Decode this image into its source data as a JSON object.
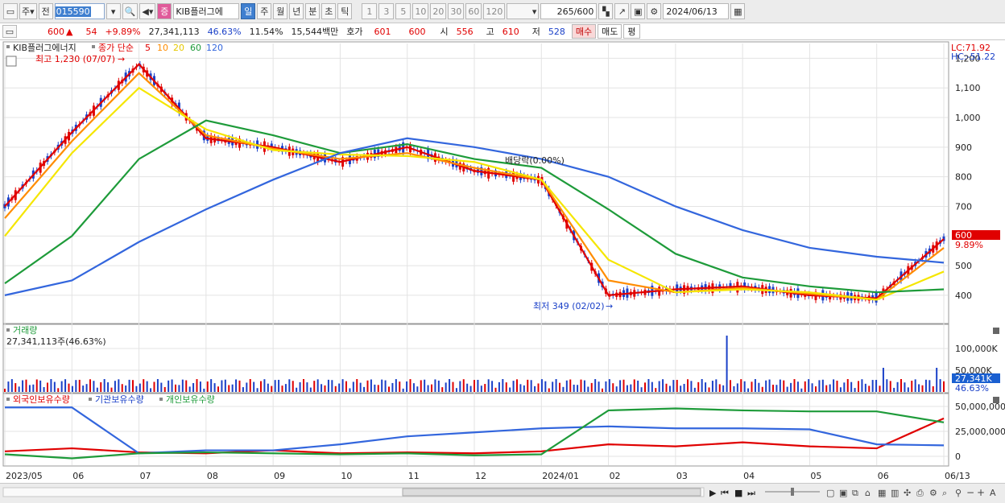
{
  "toolbar": {
    "market": "주",
    "prev": "전",
    "code": "015590",
    "name": "KIB플러그에",
    "periods": [
      "일",
      "주",
      "월",
      "년",
      "분",
      "초",
      "틱"
    ],
    "active_period": "일",
    "minutes": [
      "1",
      "3",
      "5",
      "10",
      "20",
      "30",
      "60",
      "120"
    ],
    "count": "265/600",
    "date": "2024/06/13"
  },
  "info": {
    "price": "600",
    "change": "54",
    "change_pct": "+9.89%",
    "volume": "27,341,113",
    "volume_ratio": "46.63%",
    "turnover": "11.54%",
    "amount": "15,544백만",
    "quote_label": "호가",
    "ask": "601",
    "bid": "600",
    "open_label": "시",
    "open": "556",
    "high_label": "고",
    "high": "610",
    "low_label": "저",
    "low": "528",
    "buy": "매수",
    "sell": "매도",
    "eval": "평"
  },
  "price_panel": {
    "legend_name": "KIB플러그에너지",
    "legend_ma": "종가 단순",
    "ma_periods": [
      "5",
      "10",
      "20",
      "60",
      "120"
    ],
    "ma_colors": [
      "#e00000",
      "#ff8c00",
      "#f5e600",
      "#1e9b3a",
      "#3366dd"
    ],
    "high_label": "최고 1,230 (07/07)",
    "low_label": "최저 349 (02/02)",
    "dividend_label": "배당락(0.00%)",
    "lc": "LC:71.92",
    "hc": "HC:-51.22",
    "current_price_tag": "600",
    "current_pct_tag": "9.89%",
    "y_ticks": [
      "1,200",
      "1,100",
      "1,000",
      "900",
      "800",
      "700",
      "600",
      "500",
      "400"
    ]
  },
  "volume_panel": {
    "title": "거래량",
    "value": "27,341,113주(46.63%)",
    "y_ticks": [
      "100,000K",
      "50,000K"
    ],
    "tag": "27,341K",
    "tag_pct": "46.63%"
  },
  "holdings_panel": {
    "legend": [
      "외국인보유수량",
      "기관보유수량",
      "개인보유수량"
    ],
    "y_ticks": [
      "50,000,000",
      "25,000,000",
      "0"
    ]
  },
  "x_axis": [
    "2023/05",
    "06",
    "07",
    "08",
    "09",
    "10",
    "11",
    "12",
    "2024/01",
    "02",
    "03",
    "04",
    "05",
    "06",
    "06/13"
  ],
  "chart_data": {
    "type": "line",
    "title": "",
    "xlabel": "",
    "ylabel": "",
    "x": [
      "2023/05",
      "06",
      "07",
      "08",
      "09",
      "10",
      "11",
      "12",
      "2024/01",
      "02",
      "03",
      "04",
      "05",
      "06",
      "06/13"
    ],
    "ylim": [
      310,
      1250
    ],
    "series": [
      {
        "name": "5",
        "values": [
          700,
          950,
          1180,
          930,
          900,
          850,
          900,
          820,
          790,
          400,
          420,
          430,
          400,
          390,
          590
        ]
      },
      {
        "name": "10",
        "values": [
          660,
          920,
          1150,
          940,
          895,
          860,
          880,
          830,
          790,
          450,
          410,
          425,
          405,
          385,
          560
        ]
      },
      {
        "name": "20",
        "values": [
          600,
          880,
          1100,
          960,
          890,
          875,
          870,
          850,
          790,
          520,
          410,
          420,
          410,
          385,
          480
        ]
      },
      {
        "name": "60",
        "values": [
          440,
          600,
          860,
          990,
          940,
          880,
          910,
          860,
          830,
          690,
          540,
          460,
          430,
          410,
          420
        ]
      },
      {
        "name": "120",
        "values": [
          400,
          450,
          580,
          690,
          790,
          880,
          930,
          900,
          860,
          800,
          700,
          620,
          560,
          530,
          510
        ]
      }
    ]
  }
}
